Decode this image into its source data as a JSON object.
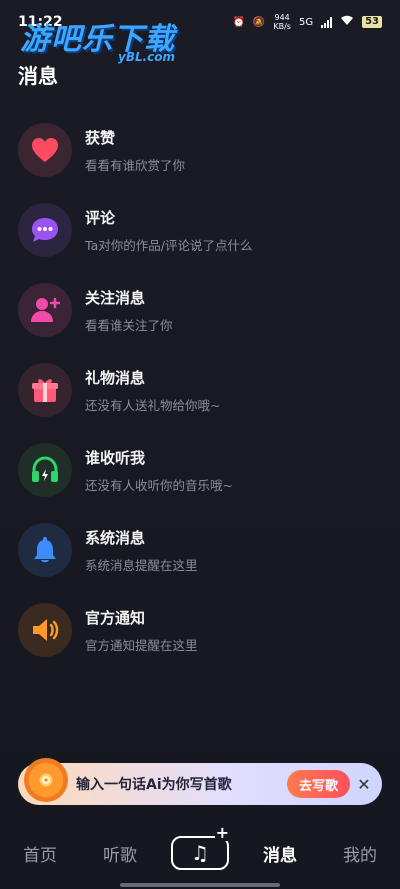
{
  "status_bar": {
    "time": "11:22",
    "net_speed_value": "944",
    "net_speed_unit": "KB/s",
    "network": "5G",
    "battery": "53"
  },
  "watermark": {
    "text": "游吧乐下载",
    "sub": "yBL.com"
  },
  "page": {
    "title": "消息"
  },
  "messages": [
    {
      "title": "获赞",
      "subtitle": "看看有谁欣赏了你",
      "icon": "heart-icon",
      "bg": "#3a2530",
      "color": "#ff4a5f"
    },
    {
      "title": "评论",
      "subtitle": "Ta对你的作品/评论说了点什么",
      "icon": "chat-bubble-icon",
      "bg": "#2b2540",
      "color": "#9b52f2"
    },
    {
      "title": "关注消息",
      "subtitle": "看看谁关注了你",
      "icon": "person-add-icon",
      "bg": "#3a2436",
      "color": "#f14aa8"
    },
    {
      "title": "礼物消息",
      "subtitle": "还没有人送礼物给你哦~",
      "icon": "gift-icon",
      "bg": "#35242e",
      "color": "#ff5a7a"
    },
    {
      "title": "谁收听我",
      "subtitle": "还没有人收听你的音乐哦~",
      "icon": "headphones-icon",
      "bg": "#1f2f27",
      "color": "#2fd46a"
    },
    {
      "title": "系统消息",
      "subtitle": "系统消息提醒在这里",
      "icon": "bell-icon",
      "bg": "#1f2b40",
      "color": "#3d8cff"
    },
    {
      "title": "官方通知",
      "subtitle": "官方通知提醒在这里",
      "icon": "speaker-icon",
      "bg": "#3a2a20",
      "color": "#ff9a2a"
    }
  ],
  "banner": {
    "text": "输入一句话Ai为你写首歌",
    "button": "去写歌",
    "close": "✕"
  },
  "tabbar": {
    "home": "首页",
    "listen": "听歌",
    "create_plus": "+",
    "create_glyph": "♫",
    "messages": "消息",
    "mine": "我的"
  }
}
